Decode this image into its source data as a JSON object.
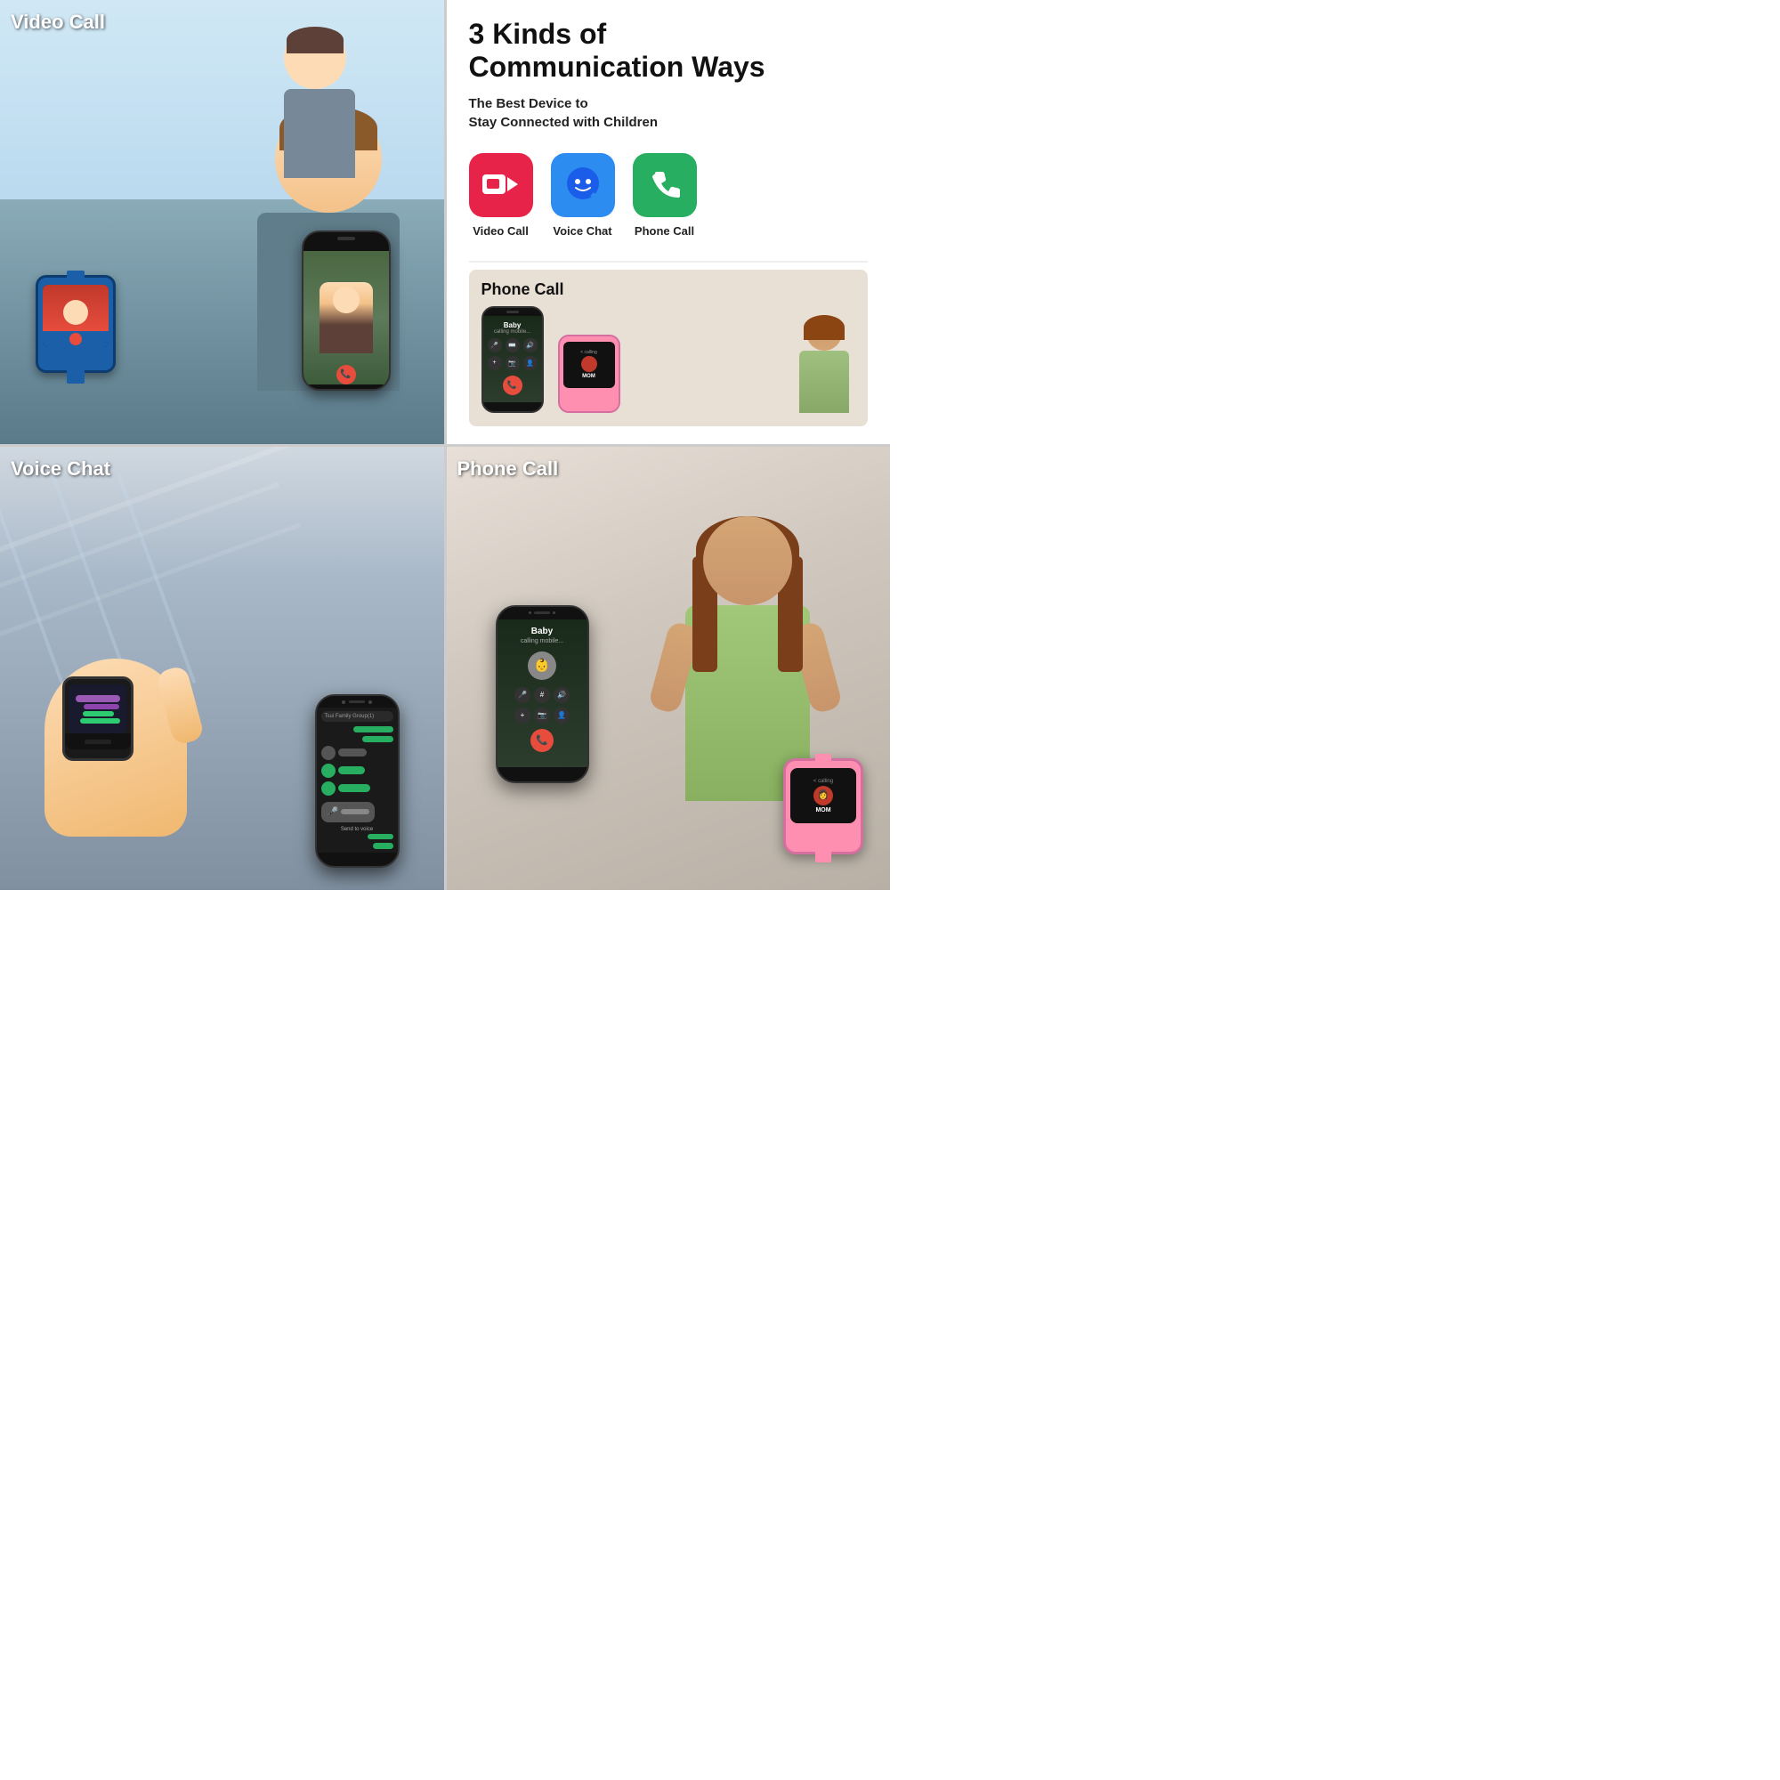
{
  "title": "3 Kinds of Communication Ways",
  "subtitle": "The Best Device to Stay Connected with Children",
  "sections": {
    "video_call": {
      "label": "Video Call"
    },
    "voice_chat": {
      "label": "Voice Chat"
    },
    "phone_call": {
      "label": "Phone Call"
    },
    "info": {
      "title": "3 Kinds of\nCommunication Ways",
      "title_line1": "3 Kinds of",
      "title_line2": "Communication Ways",
      "subtitle": "The Best Device to\nStay Connected with Children",
      "subtitle_line1": "The Best Device to",
      "subtitle_line2": "Stay Connected with Children",
      "icons": [
        {
          "label": "Video Call",
          "type": "video"
        },
        {
          "label": "Voice Chat",
          "type": "voice"
        },
        {
          "label": "Phone Call",
          "type": "phone"
        }
      ]
    }
  },
  "call_ui": {
    "caller_name": "Baby",
    "call_status": "calling mobile...",
    "watch_label": "< calling",
    "watch_name": "MOM"
  },
  "voice_ui": {
    "group_name": "Tsui Family Group(1)",
    "send_voice": "Send to voice"
  }
}
